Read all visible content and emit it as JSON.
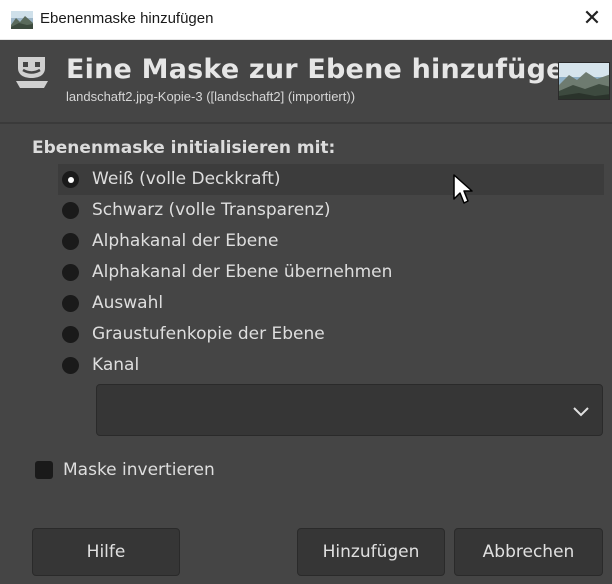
{
  "window": {
    "title": "Ebenenmaske hinzufügen",
    "close_glyph": "✕"
  },
  "header": {
    "title": "Eine Maske zur Ebene hinzufügen",
    "subtitle": "landschaft2.jpg-Kopie-3 ([landschaft2] (importiert))"
  },
  "init": {
    "label": "Ebenenmaske initialisieren mit:",
    "options": [
      {
        "label": "Weiß (volle Deckkraft)",
        "selected": true
      },
      {
        "label": "Schwarz (volle Transparenz)",
        "selected": false
      },
      {
        "label": "Alphakanal der Ebene",
        "selected": false
      },
      {
        "label": "Alphakanal der Ebene übernehmen",
        "selected": false
      },
      {
        "label": "Auswahl",
        "selected": false
      },
      {
        "label": "Graustufenkopie der Ebene",
        "selected": false
      },
      {
        "label": "Kanal",
        "selected": false
      }
    ],
    "channel_select_value": ""
  },
  "invert": {
    "label": "Maske invertieren",
    "checked": false
  },
  "buttons": {
    "help": "Hilfe",
    "add": "Hinzufügen",
    "cancel": "Abbrechen"
  },
  "icons": {
    "app": "gimp-landscape-icon",
    "header": "layer-mask-icon",
    "thumbnail": "layer-thumbnail",
    "chevron": "chevron-down-icon",
    "cursor": "mouse-pointer-icon"
  },
  "colors": {
    "background": "#454545",
    "text": "#dedede",
    "radio": "#1a1a1a",
    "titlebar": "#ffffff"
  }
}
